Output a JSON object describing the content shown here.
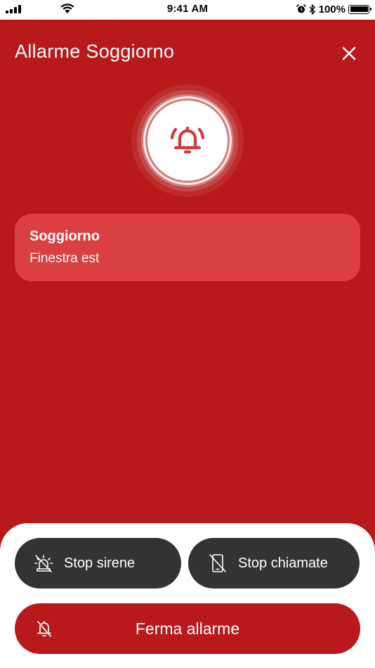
{
  "status_bar": {
    "time": "9:41 AM",
    "battery": "100%",
    "battery_level": 1.0
  },
  "header": {
    "title": "Allarme Soggiorno"
  },
  "icons": {
    "close": "close-icon",
    "bell": "bell-ringing-icon",
    "siren_off": "siren-off-icon",
    "phone_off": "phone-off-icon",
    "bell_off": "bell-off-icon"
  },
  "sensor": {
    "room": "Soggiorno",
    "device": "Finestra est"
  },
  "actions": {
    "stop_sirens": "Stop sirene",
    "stop_calls": "Stop chiamate",
    "stop_alarm": "Ferma allarme"
  },
  "colors": {
    "alarm_red": "#b8191b",
    "card_red": "#da4042",
    "dark_button": "#333334",
    "icon_red": "#d5393b"
  }
}
